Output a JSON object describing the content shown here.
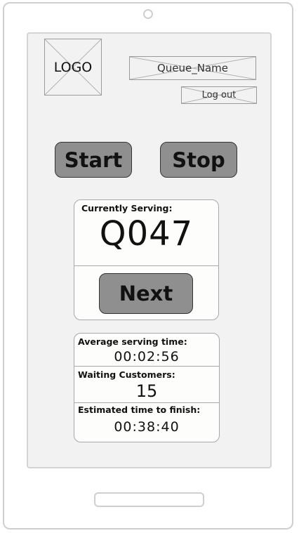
{
  "header": {
    "logo_text": "LOGO",
    "queue_name": "Queue_Name",
    "logout_label": "Log out"
  },
  "controls": {
    "start_label": "Start",
    "stop_label": "Stop"
  },
  "serving": {
    "label": "Currently Serving:",
    "ticket": "Q047",
    "next_label": "Next"
  },
  "stats": {
    "avg_label": "Average serving time:",
    "avg_value": "00:02:56",
    "waiting_label": "Waiting Customers:",
    "waiting_value": "15",
    "eta_label": "Estimated time to finish:",
    "eta_value": "00:38:40"
  },
  "colors": {
    "button_fill": "#8f8f8f",
    "screen_bg": "#f2f2f2",
    "card_bg": "#fdfdfc"
  }
}
